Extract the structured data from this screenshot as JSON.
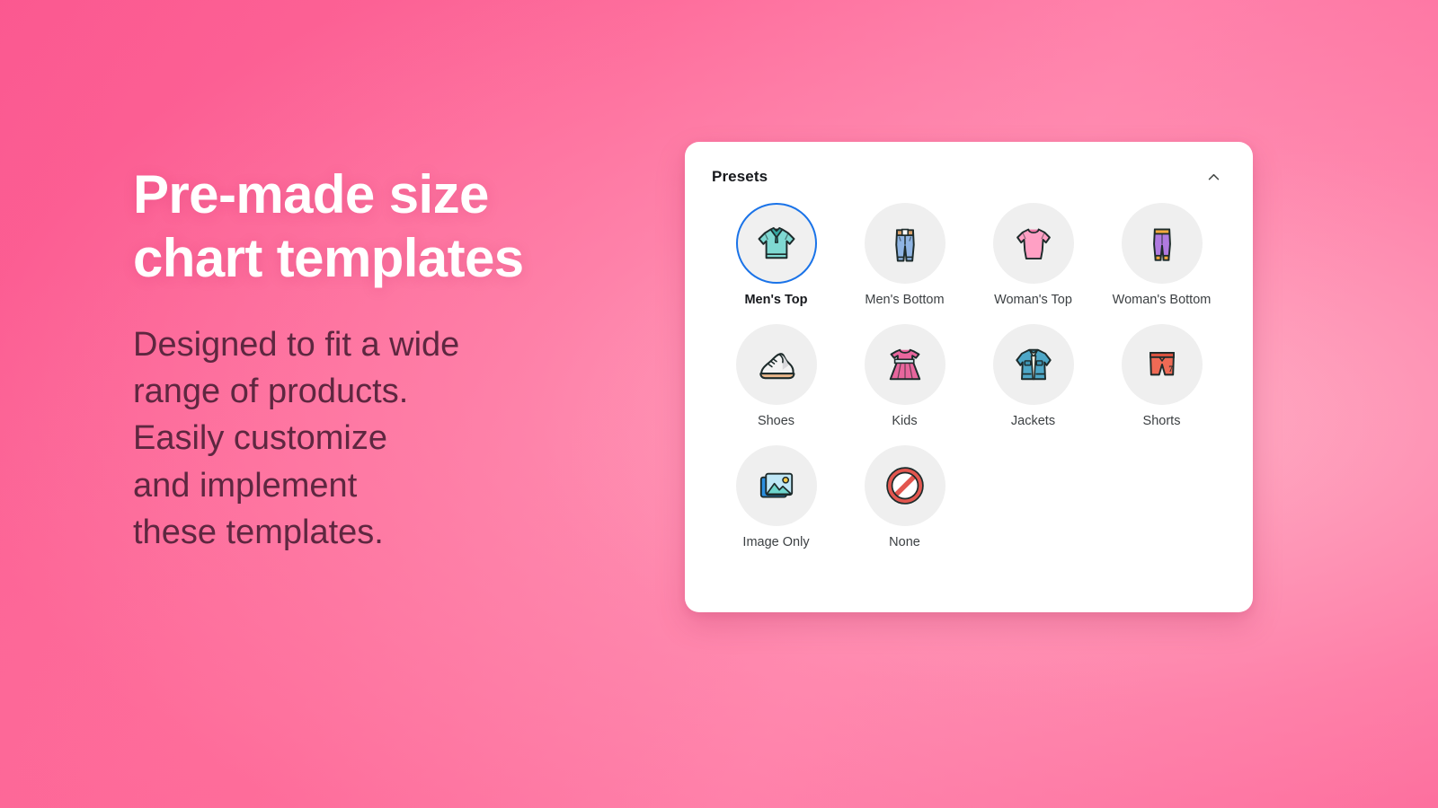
{
  "hero": {
    "headline": "Pre-made size\nchart templates",
    "subcopy": "Designed to fit a wide\nrange of products.\nEasily customize\nand implement\nthese templates.",
    "headline_color": "#ffffff",
    "subcopy_color": "#5e2740",
    "background_pink": "#fc5f94"
  },
  "card": {
    "title": "Presets",
    "collapse_icon": "chevron-up-icon",
    "background": "#ffffff",
    "selected_ring_color": "#1a73e8",
    "swatch_background": "#efefef",
    "presets": [
      {
        "id": "mens-top",
        "label": "Men's Top",
        "icon": "polo-shirt-icon",
        "selected": true
      },
      {
        "id": "mens-bottom",
        "label": "Men's Bottom",
        "icon": "jeans-icon",
        "selected": false
      },
      {
        "id": "womans-top",
        "label": "Woman's Top",
        "icon": "womens-tshirt-icon",
        "selected": false
      },
      {
        "id": "womans-bottom",
        "label": "Woman's Bottom",
        "icon": "leggings-icon",
        "selected": false
      },
      {
        "id": "shoes",
        "label": "Shoes",
        "icon": "sneaker-icon",
        "selected": false
      },
      {
        "id": "kids",
        "label": "Kids",
        "icon": "dress-icon",
        "selected": false
      },
      {
        "id": "jackets",
        "label": "Jackets",
        "icon": "denim-jacket-icon",
        "selected": false
      },
      {
        "id": "shorts",
        "label": "Shorts",
        "icon": "shorts-icon",
        "selected": false
      },
      {
        "id": "image-only",
        "label": "Image Only",
        "icon": "picture-icon",
        "selected": false
      },
      {
        "id": "none",
        "label": "None",
        "icon": "prohibited-icon",
        "selected": false
      }
    ]
  }
}
